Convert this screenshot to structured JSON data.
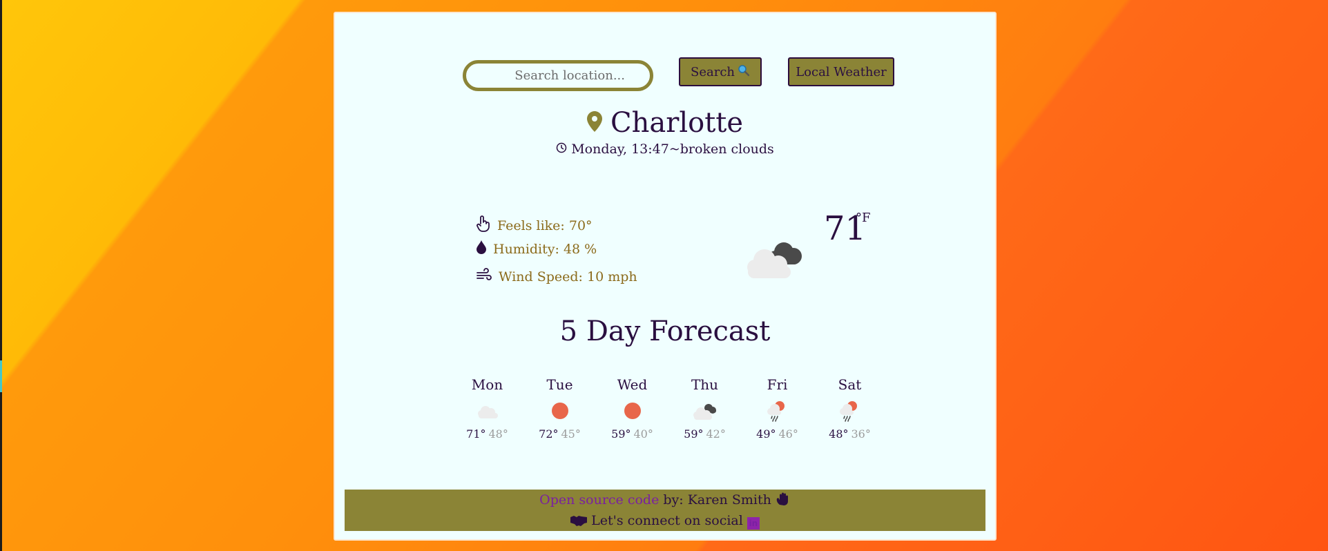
{
  "search": {
    "placeholder": "Search location...",
    "button_label": "Search",
    "local_label": "Local Weather"
  },
  "location": {
    "city": "Charlotte",
    "datetime": "Monday, 13:47~broken clouds"
  },
  "current": {
    "feels_like": "Feels like: 70°",
    "humidity": "Humidity: 48 %",
    "wind": "Wind Speed: 10 mph",
    "temperature": "71",
    "unit": "°F",
    "condition_icon": "broken-clouds-icon"
  },
  "forecast": {
    "title": "5 Day Forecast",
    "days": [
      {
        "name": "Mon",
        "high": "71°",
        "low": "48°",
        "icon": "cloud-icon"
      },
      {
        "name": "Tue",
        "high": "72°",
        "low": "45°",
        "icon": "sun-icon"
      },
      {
        "name": "Wed",
        "high": "59°",
        "low": "40°",
        "icon": "sun-icon"
      },
      {
        "name": "Thu",
        "high": "59°",
        "low": "42°",
        "icon": "broken-clouds-icon"
      },
      {
        "name": "Fri",
        "high": "49°",
        "low": "46°",
        "icon": "rain-sun-icon"
      },
      {
        "name": "Sat",
        "high": "48°",
        "low": "36°",
        "icon": "rain-sun-icon"
      }
    ]
  },
  "footer": {
    "link_text": "Open source code",
    "by_text": " by: Karen Smith",
    "social_text": "Let's connect on social"
  },
  "colors": {
    "accent": "#8b8436",
    "text": "#2a0f40",
    "detail": "#8b6a1a",
    "card": "#f0ffff",
    "sun": "#e8664a",
    "link": "#7a1fa2"
  }
}
